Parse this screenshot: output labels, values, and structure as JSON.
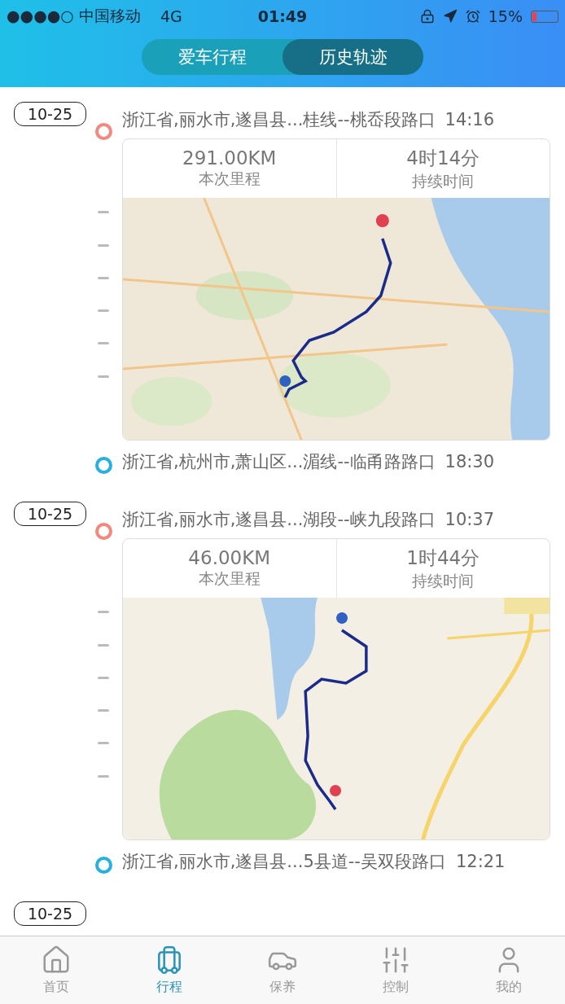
{
  "status_bar": {
    "carrier": "●●●●○ 中国移动",
    "network": "4G",
    "time": "01:49",
    "battery": "15%"
  },
  "tabs": [
    {
      "label": "爱车行程",
      "selected": false
    },
    {
      "label": "历史轨迹",
      "selected": true
    }
  ],
  "trips": [
    {
      "date": "10-25",
      "start": {
        "address": "浙江省,丽水市,遂昌县...桂线--桃岙段路口",
        "time": "14:16"
      },
      "distance": "291.00KM",
      "distance_label": "本次里程",
      "duration": "4时14分",
      "duration_label": "持续时间",
      "end": {
        "address": "浙江省,杭州市,萧山区...湄线--临甬路路口",
        "time": "18:30"
      }
    },
    {
      "date": "10-25",
      "start": {
        "address": "浙江省,丽水市,遂昌县...湖段--峡九段路口",
        "time": "10:37"
      },
      "distance": "46.00KM",
      "distance_label": "本次里程",
      "duration": "1时44分",
      "duration_label": "持续时间",
      "end": {
        "address": "浙江省,丽水市,遂昌县...5县道--吴双段路口",
        "time": "12:21"
      }
    },
    {
      "date": "10-25"
    }
  ],
  "tab_bar": [
    {
      "label": "首页",
      "selected": false
    },
    {
      "label": "行程",
      "selected": true
    },
    {
      "label": "保养",
      "selected": false
    },
    {
      "label": "控制",
      "selected": false
    },
    {
      "label": "我的",
      "selected": false
    }
  ]
}
